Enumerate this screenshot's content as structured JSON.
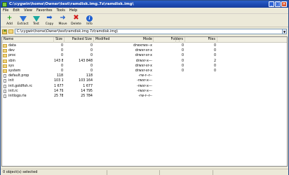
{
  "window": {
    "title": "C:\\cygwin\\home\\Owner\\test\\ramdisk.img.7z\\ramdisk.img\\",
    "minimize_glyph": "_",
    "maximize_glyph": "□",
    "close_glyph": "×"
  },
  "menu": [
    "File",
    "Edit",
    "View",
    "Favorites",
    "Tools",
    "Help"
  ],
  "toolbar": [
    {
      "label": "Add",
      "icon": "add-icon"
    },
    {
      "label": "Extract",
      "icon": "extract-icon"
    },
    {
      "label": "Test",
      "icon": "test-icon"
    },
    {
      "label": "Copy",
      "icon": "copy-icon"
    },
    {
      "label": "Move",
      "icon": "move-icon"
    },
    {
      "label": "Delete",
      "icon": "delete-icon"
    },
    {
      "label": "Info",
      "icon": "info-icon"
    }
  ],
  "address": {
    "path": "C:\\cygwin\\home\\Owner\\test\\ramdisk.img.7z\\ramdisk.img\\"
  },
  "columns": {
    "name": "Name",
    "size": "Size",
    "packed": "Packed Size",
    "modified": "Modified",
    "mode": "Mode",
    "folders": "Folders",
    "files": "Files"
  },
  "rows": [
    {
      "name": "data",
      "type": "folder",
      "size": "0",
      "packed": "0",
      "mode": "drwxrwx--x",
      "folders": "0",
      "files": "0"
    },
    {
      "name": "dev",
      "type": "folder",
      "size": "0",
      "packed": "0",
      "mode": "drwxr-xr-x",
      "folders": "0",
      "files": "0"
    },
    {
      "name": "proc",
      "type": "folder",
      "size": "0",
      "packed": "0",
      "mode": "drwxr-xr-x",
      "folders": "0",
      "files": "0"
    },
    {
      "name": "sbin",
      "type": "folder",
      "size": "143 848",
      "packed": "143 848",
      "mode": "drwxr-x---",
      "folders": "0",
      "files": "2"
    },
    {
      "name": "sys",
      "type": "folder",
      "size": "0",
      "packed": "0",
      "mode": "drwxr-xr-x",
      "folders": "0",
      "files": "0"
    },
    {
      "name": "system",
      "type": "folder",
      "size": "0",
      "packed": "0",
      "mode": "drwxr-xr-x",
      "folders": "0",
      "files": "0"
    },
    {
      "name": "default.prop",
      "type": "file",
      "size": "118",
      "packed": "118",
      "mode": "-rw-r--r--",
      "folders": "",
      "files": ""
    },
    {
      "name": "init",
      "type": "file",
      "size": "103 164",
      "packed": "103 164",
      "mode": "-rwxr-x---",
      "folders": "",
      "files": ""
    },
    {
      "name": "init.goldfish.rc",
      "type": "file",
      "size": "1 677",
      "packed": "1 677",
      "mode": "-rwxr-x---",
      "folders": "",
      "files": ""
    },
    {
      "name": "init.rc",
      "type": "file",
      "size": "14 795",
      "packed": "14 795",
      "mode": "-rwxr-x---",
      "folders": "",
      "files": ""
    },
    {
      "name": "initlogo.rle",
      "type": "file",
      "size": "25 784",
      "packed": "25 784",
      "mode": "-rw-r--r--",
      "folders": "",
      "files": ""
    }
  ],
  "status": {
    "text": "0 object(s) selected"
  }
}
